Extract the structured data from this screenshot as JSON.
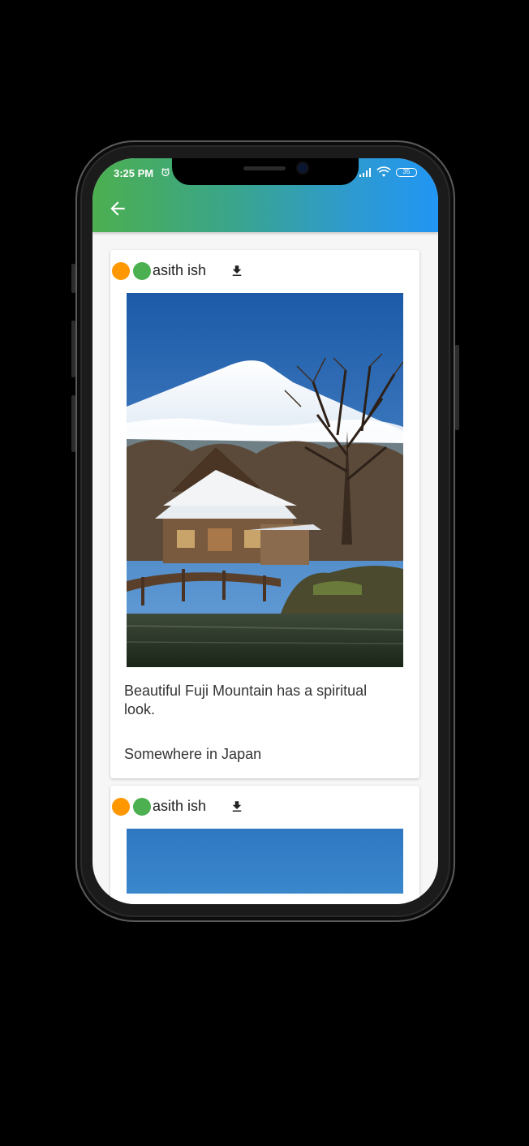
{
  "status_bar": {
    "time": "3:25 PM",
    "battery": "35"
  },
  "app_bar": {
    "back_icon": "arrow-back-icon"
  },
  "colors": {
    "orange_dot": "#ff9800",
    "green_dot": "#4caf50",
    "gradient_start": "#4caf50",
    "gradient_end": "#2196f3"
  },
  "posts": [
    {
      "username": "asith ish",
      "download_icon": "download-icon",
      "caption": "Beautiful Fuji Mountain has a spiritual look.",
      "location": "Somewhere in Japan"
    },
    {
      "username": "asith ish",
      "download_icon": "download-icon"
    }
  ]
}
